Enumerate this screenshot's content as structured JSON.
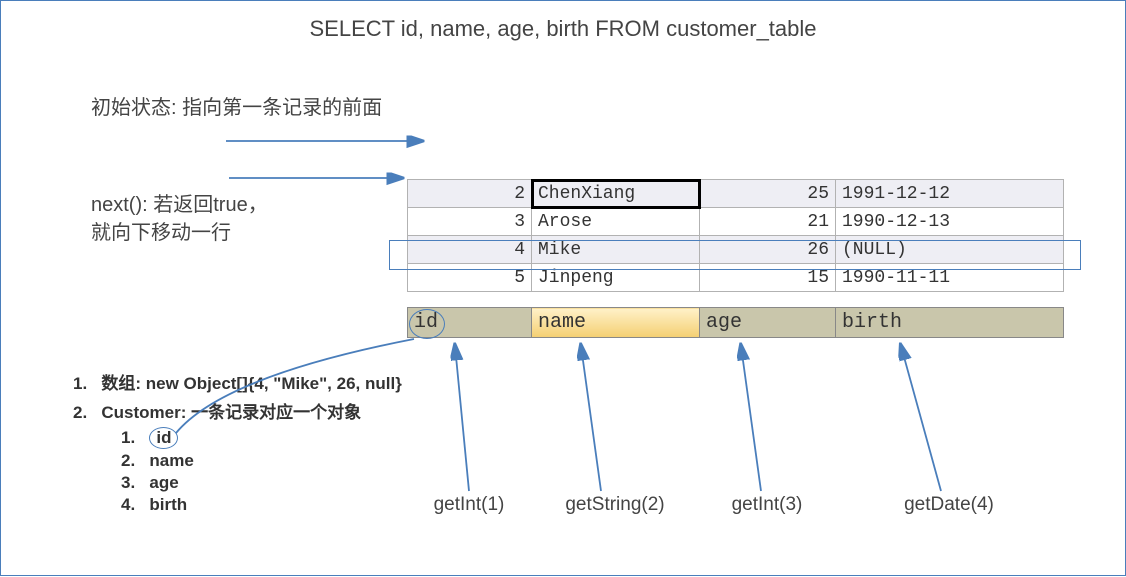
{
  "title": "SELECT id, name, age, birth FROM customer_table",
  "initialState": "初始状态: 指向第一条记录的前面",
  "nextDesc_line1": "next(): 若返回true，",
  "nextDesc_line2": "就向下移动一行",
  "rows": [
    {
      "id": "2",
      "name": "ChenXiang",
      "age": "25",
      "birth": "1991-12-12"
    },
    {
      "id": "3",
      "name": "Arose",
      "age": "21",
      "birth": "1990-12-13"
    },
    {
      "id": "4",
      "name": "Mike",
      "age": "26",
      "birth": "(NULL)"
    },
    {
      "id": "5",
      "name": "Jinpeng",
      "age": "15",
      "birth": "1990-11-11"
    }
  ],
  "headers": {
    "c1": "id",
    "c2": "name",
    "c3": "age",
    "c4": "birth"
  },
  "list": {
    "item1_num": "1.",
    "item1_label": "数组",
    "item1_rest": ": new Object[]{4, \"Mike\", 26, null}",
    "item2_num": "2.",
    "item2_label": "Customer",
    "item2_rest": ": 一条记录对应一个对象",
    "sub": [
      {
        "n": "1.",
        "v": "id"
      },
      {
        "n": "2.",
        "v": "name"
      },
      {
        "n": "3.",
        "v": "age"
      },
      {
        "n": "4.",
        "v": "birth"
      }
    ]
  },
  "getters": {
    "g1": "getInt(1)",
    "g2": "getString(2)",
    "g3": "getInt(3)",
    "g4": "getDate(4)"
  }
}
